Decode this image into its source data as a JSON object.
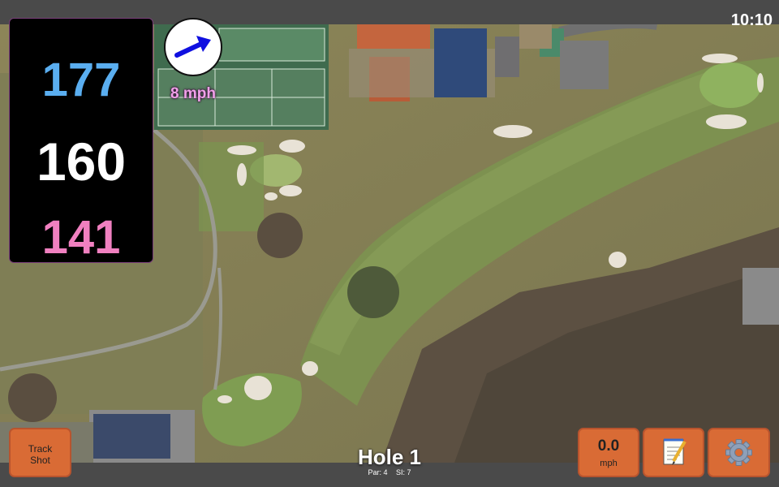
{
  "status_bar": {
    "time": "10:10"
  },
  "distances": {
    "back": "177",
    "middle": "160",
    "front": "141"
  },
  "wind": {
    "speed_text": "8 mph",
    "icon": "wind-arrow-icon"
  },
  "buttons": {
    "track_shot_line1": "Track",
    "track_shot_line2": "Shot",
    "speed_value": "0.0",
    "speed_unit": "mph",
    "notes_icon": "notepad-icon",
    "settings_icon": "gear-icon"
  },
  "hole": {
    "title": "Hole 1",
    "par": "Par: 4",
    "si": "SI: 7"
  },
  "colors": {
    "back_distance": "#5aaef0",
    "middle_distance": "#ffffff",
    "front_distance": "#f080c0",
    "button_orange": "#d96b35",
    "wind_text": "#f0a0e8",
    "wind_arrow": "#1010e0"
  }
}
